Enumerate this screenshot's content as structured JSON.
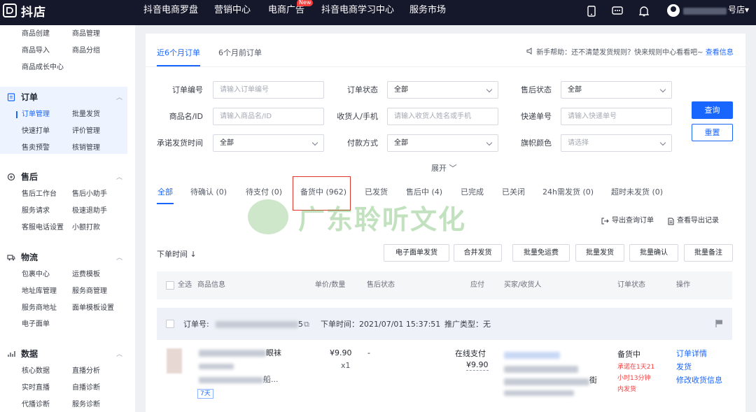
{
  "topbar": {
    "brand": "抖店",
    "logo_glyph": "ꟷ",
    "nav": [
      "抖音电商罗盘",
      "营销中心",
      "电商广告",
      "抖音电商学习中心",
      "服务市场"
    ],
    "nav_badge": "New",
    "store_suffix": "号店▾",
    "icons": [
      "phone-icon",
      "message-icon",
      "bell-icon",
      "avatar-icon"
    ]
  },
  "sidebar": {
    "top_items": [
      [
        "商品创建",
        "商品管理"
      ],
      [
        "商品导入",
        "商品分组"
      ],
      [
        "商品成长中心"
      ]
    ],
    "groups": [
      {
        "title": "订单",
        "icon": "order-icon",
        "items": [
          [
            "订单管理",
            "批量发货"
          ],
          [
            "快速打单",
            "评价管理"
          ],
          [
            "售卖预警",
            "核销管理"
          ]
        ]
      },
      {
        "title": "售后",
        "icon": "aftersale-icon",
        "items": [
          [
            "售后工作台",
            "售后小助手"
          ],
          [
            "服务请求",
            "极速退助手"
          ],
          [
            "客服电话设置",
            "小额打款"
          ]
        ]
      },
      {
        "title": "物流",
        "icon": "logistics-icon",
        "items": [
          [
            "包裹中心",
            "运费模板"
          ],
          [
            "地址库管理",
            "服务商管理"
          ],
          [
            "服务商地址",
            "面单模板设置"
          ],
          [
            "电子面单"
          ]
        ]
      },
      {
        "title": "数据",
        "icon": "data-icon",
        "items": [
          [
            "核心数据",
            "直播分析"
          ],
          [
            "实时直播",
            "自播诊断"
          ],
          [
            "代播诊断",
            "服务诊断"
          ]
        ]
      }
    ]
  },
  "tabs": [
    "近6个月订单",
    "6个月前订单"
  ],
  "help": {
    "text": "新手帮助：还不清楚发货规则？快来规则中心看看吧~",
    "link": "查看信息"
  },
  "filters": [
    {
      "label": "订单编号",
      "value": "请输入订单编号",
      "placeholder": true,
      "select": false
    },
    {
      "label": "订单状态",
      "value": "全部",
      "placeholder": false,
      "select": true
    },
    {
      "label": "售后状态",
      "value": "全部",
      "placeholder": false,
      "select": true
    },
    {
      "label": "商品名/ID",
      "value": "请输入商品名/ID",
      "placeholder": true,
      "select": false
    },
    {
      "label": "收货人/手机",
      "value": "请输入收货人姓名或手机",
      "placeholder": true,
      "select": false
    },
    {
      "label": "快递单号",
      "value": "请输入快递单号",
      "placeholder": true,
      "select": false
    },
    {
      "label": "承诺发货时间",
      "value": "全部",
      "placeholder": false,
      "select": true
    },
    {
      "label": "付款方式",
      "value": "全部",
      "placeholder": false,
      "select": true
    },
    {
      "label": "旗帜颜色",
      "value": "请选择",
      "placeholder": true,
      "select": true
    }
  ],
  "buttons": {
    "query": "查询",
    "reset": "重置",
    "expand": "展开"
  },
  "status_tabs": [
    "全部",
    "待确认  (0)",
    "待支付  (0)",
    "备货中  (962)",
    "已发货",
    "售后中  (4)",
    "已完成",
    "已关闭",
    "24h需发货  (0)",
    "超时未发货  (0)"
  ],
  "watermark": "广东聆听文化",
  "export": {
    "export_orders": "导出查询订单",
    "view_records": "查看导出记录"
  },
  "sort_label": "下单时间",
  "actions": [
    "电子面单发货",
    "合并发货",
    "批量免运费",
    "批量发货",
    "批量确认",
    "批量备注"
  ],
  "table_headers": {
    "select_all": "全选",
    "product": "商品信息",
    "price_qty": "单价/数量",
    "aftersale": "售后状态",
    "payable": "应付",
    "buyer": "买家/收货人",
    "status": "订单状态",
    "ops": "操作"
  },
  "order": {
    "number_label": "订单号:",
    "number_tail": "5",
    "time": "下单时间：2021/07/01 15:37:51",
    "promo": "推广类型：无",
    "product_tail": "眼袜",
    "product_tail2": "船...",
    "days_tag": "7天",
    "price": "¥9.90",
    "qty": "x1",
    "aftersale": "-",
    "pay_method": "在线支付",
    "pay_amount": "¥9.90",
    "buyer_tail": "街",
    "status": "备货中",
    "promise": [
      "承诺在1天21",
      "小时13分钟",
      "内发货"
    ],
    "ops": [
      "订单详情",
      "发货",
      "修改收货信息"
    ]
  }
}
